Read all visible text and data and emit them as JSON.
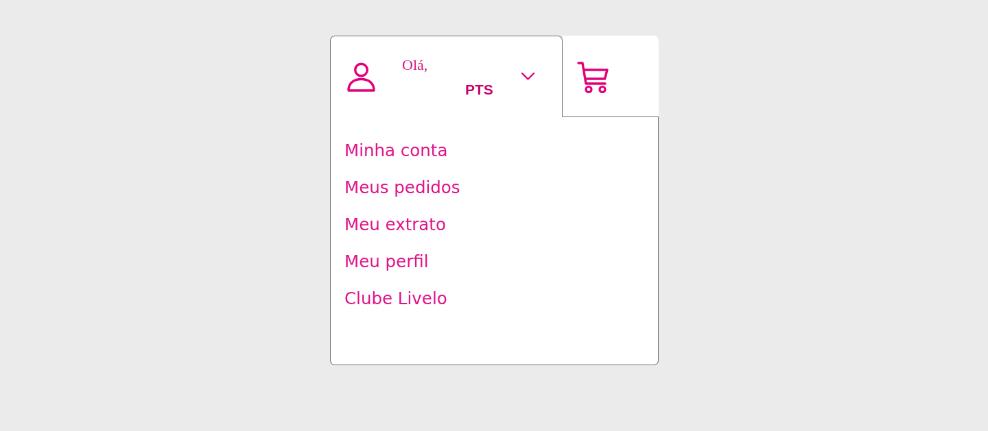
{
  "account": {
    "greeting": "Olá,",
    "points_unit": "PTS",
    "expanded": true
  },
  "menu_items": [
    {
      "label": "Minha conta"
    },
    {
      "label": "Meus pedidos"
    },
    {
      "label": "Meu extrato"
    },
    {
      "label": "Meu perfil"
    },
    {
      "label": "Clube Livelo"
    }
  ]
}
